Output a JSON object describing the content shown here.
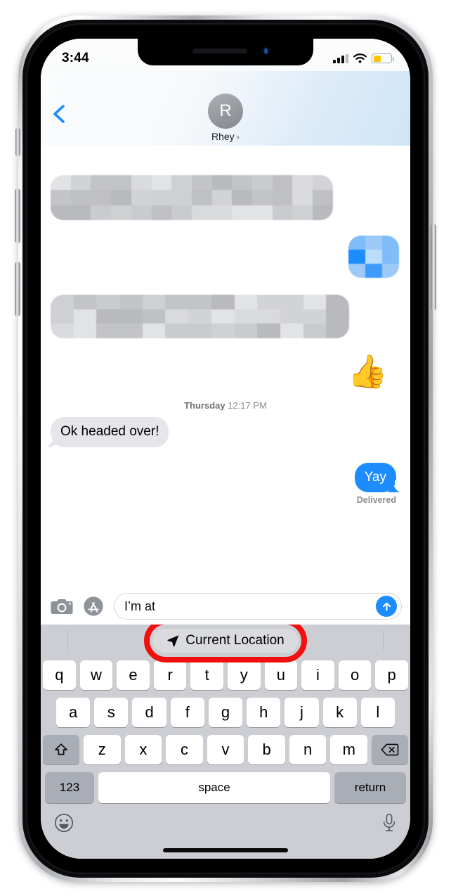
{
  "device": {
    "frame": "iphone",
    "home_indicator": true
  },
  "status_bar": {
    "time": "3:44",
    "signal_icon": "cellular-bars-icon",
    "signal_bars_filled": 3,
    "signal_bars_total": 4,
    "wifi_icon": "wifi-icon",
    "battery_icon": "battery-icon",
    "battery_level_pct": 45,
    "battery_color": "#fdc500"
  },
  "nav_bar": {
    "back_icon": "back-chevron-icon",
    "avatar_initial": "R",
    "contact_name": "Rhey",
    "detail_chevron": "›"
  },
  "conversation": {
    "messages": [
      {
        "id": "m1",
        "side": "left",
        "type": "redacted",
        "rows": 3,
        "cols": 14
      },
      {
        "id": "m2",
        "side": "right",
        "type": "redacted-blue",
        "rows": 3,
        "cols": 3
      },
      {
        "id": "m3",
        "side": "left",
        "type": "redacted",
        "rows": 3,
        "cols": 13
      },
      {
        "id": "m4",
        "side": "right",
        "type": "emoji",
        "text": "👍"
      }
    ],
    "daystamp_day": "Thursday",
    "daystamp_time": "12:17 PM",
    "incoming_text": "Ok headed over!",
    "outgoing_text": "Yay",
    "delivery_status": "Delivered",
    "bubble_gray": "#e6e5ea",
    "bubble_blue": "#1d8cff"
  },
  "input_bar": {
    "camera_icon": "camera-icon",
    "appstore_icon": "app-store-icon",
    "message_value": "I’m at",
    "message_placeholder": "iMessage",
    "send_icon": "send-arrow-up-icon"
  },
  "predictive_bar": {
    "suggestion_icon": "location-arrow-icon",
    "suggestion_label": "Current Location",
    "highlight_color": "#f10f0f",
    "highlight_shape": "oval"
  },
  "keyboard": {
    "row1": [
      "q",
      "w",
      "e",
      "r",
      "t",
      "y",
      "u",
      "i",
      "o",
      "p"
    ],
    "row2": [
      "a",
      "s",
      "d",
      "f",
      "g",
      "h",
      "j",
      "k",
      "l"
    ],
    "row3": [
      "z",
      "x",
      "c",
      "v",
      "b",
      "n",
      "m"
    ],
    "shift_icon": "shift-arrow-up-icon",
    "backspace_icon": "backspace-delete-icon",
    "numbers_label": "123",
    "space_label": "space",
    "return_label": "return",
    "emoji_icon": "emoji-smiley-icon",
    "dictation_icon": "microphone-icon"
  }
}
